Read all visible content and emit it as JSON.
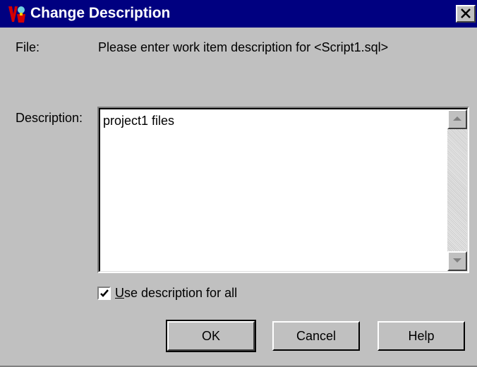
{
  "dialog": {
    "title": "Change Description",
    "title_icon": "app-wizard-icon",
    "close_icon": "close-icon"
  },
  "form": {
    "file_label": "File:",
    "file_text": "Please enter work item description for <Script1.sql>",
    "description_label": "Description:",
    "description_value": "project1 files",
    "use_for_all_label_prefix": "U",
    "use_for_all_label_rest": "se description for all",
    "use_for_all_checked": true
  },
  "buttons": {
    "ok": "OK",
    "cancel": "Cancel",
    "help": "Help"
  },
  "colors": {
    "titlebar": "#000080",
    "face": "#c0c0c0"
  }
}
